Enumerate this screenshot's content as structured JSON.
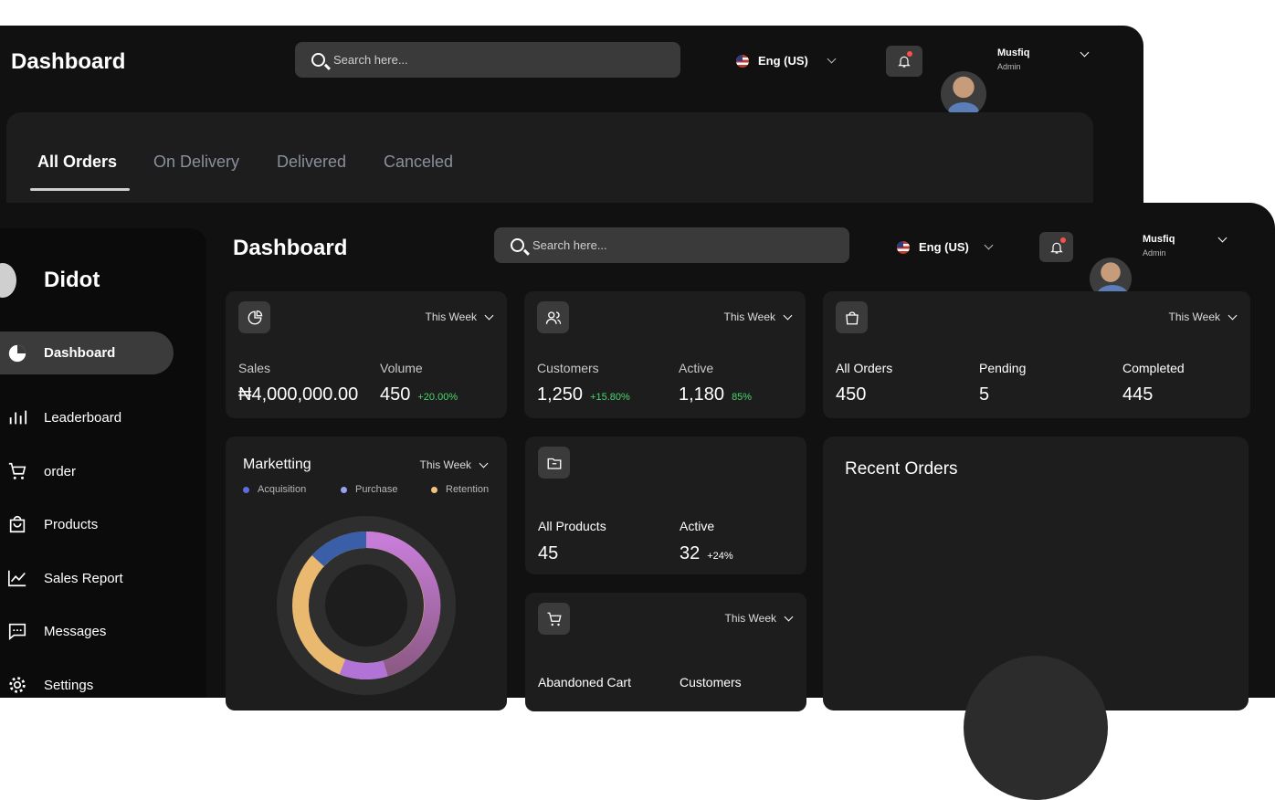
{
  "back_window": {
    "title": "Dashboard",
    "search_placeholder": "Search here...",
    "language": "Eng (US)",
    "user": {
      "name": "Musfiq",
      "role": "Admin"
    },
    "tabs": [
      "All Orders",
      "On Delivery",
      "Delivered",
      "Canceled"
    ],
    "active_tab": "All Orders"
  },
  "front_window": {
    "brand": "Didot",
    "title": "Dashboard",
    "search_placeholder": "Search here...",
    "language": "Eng (US)",
    "user": {
      "name": "Musfiq",
      "role": "Admin"
    },
    "sidebar": [
      {
        "label": "Dashboard",
        "icon": "pie-chart-icon",
        "active": true
      },
      {
        "label": "Leaderboard",
        "icon": "bar-chart-icon"
      },
      {
        "label": "order",
        "icon": "cart-icon"
      },
      {
        "label": "Products",
        "icon": "shopping-bag-icon"
      },
      {
        "label": "Sales Report",
        "icon": "line-chart-icon"
      },
      {
        "label": "Messages",
        "icon": "message-icon"
      },
      {
        "label": "Settings",
        "icon": "gear-icon"
      }
    ],
    "sales_card": {
      "period": "This Week",
      "sales_label": "Sales",
      "sales_value": "₦4,000,000.00",
      "volume_label": "Volume",
      "volume_value": "450",
      "volume_change": "+20.00%"
    },
    "customers_card": {
      "period": "This Week",
      "customers_label": "Customers",
      "customers_value": "1,250",
      "customers_change": "+15.80%",
      "active_label": "Active",
      "active_value": "1,180",
      "active_change": "85%"
    },
    "orders_card": {
      "period": "This Week",
      "all_label": "All Orders",
      "all_value": "450",
      "pending_label": "Pending",
      "pending_value": "5",
      "completed_label": "Completed",
      "completed_value": "445"
    },
    "marketing_card": {
      "title": "Marketting",
      "period": "This Week",
      "legend": [
        {
          "name": "Acquisition",
          "color": "#5b6ee1"
        },
        {
          "name": "Purchase",
          "color": "#9aa0f0"
        },
        {
          "name": "Retention",
          "color": "#f0c27a"
        }
      ]
    },
    "products_card": {
      "all_label": "All Products",
      "all_value": "45",
      "active_label": "Active",
      "active_value": "32",
      "active_change": "+24%"
    },
    "abandoned_card": {
      "period": "This Week",
      "abandoned_label": "Abandoned Cart",
      "customers_label": "Customers"
    },
    "recent_orders": {
      "title": "Recent Orders"
    }
  }
}
